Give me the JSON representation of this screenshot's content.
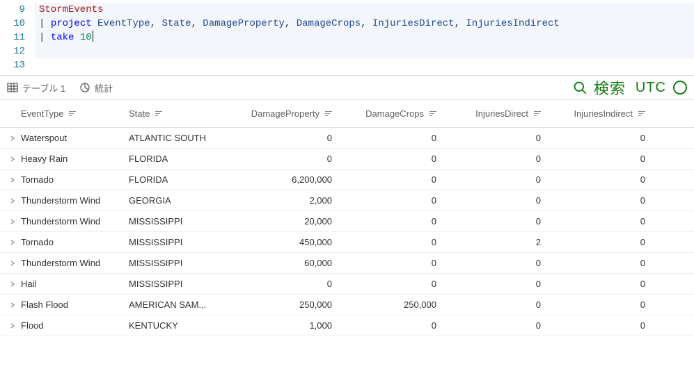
{
  "editor": {
    "lines": [
      {
        "no": "9",
        "seg": [
          {
            "c": "t-tbl",
            "t": "StormEvents"
          }
        ]
      },
      {
        "no": "10",
        "seg": [
          {
            "c": "t-pipe",
            "t": "| "
          },
          {
            "c": "t-op",
            "t": "project"
          },
          {
            "c": "",
            "t": " "
          },
          {
            "c": "t-col",
            "t": "EventType"
          },
          {
            "c": "",
            "t": ", "
          },
          {
            "c": "t-col",
            "t": "State"
          },
          {
            "c": "",
            "t": ", "
          },
          {
            "c": "t-col",
            "t": "DamageProperty"
          },
          {
            "c": "",
            "t": ", "
          },
          {
            "c": "t-col",
            "t": "DamageCrops"
          },
          {
            "c": "",
            "t": ", "
          },
          {
            "c": "t-col",
            "t": "InjuriesDirect"
          },
          {
            "c": "",
            "t": ", "
          },
          {
            "c": "t-col",
            "t": "InjuriesIndirect"
          }
        ]
      },
      {
        "no": "11",
        "seg": [
          {
            "c": "t-pipe",
            "t": "| "
          },
          {
            "c": "t-op",
            "t": "take"
          },
          {
            "c": "",
            "t": " "
          },
          {
            "c": "t-num",
            "t": "10"
          }
        ],
        "cursor": true
      },
      {
        "no": "12",
        "seg": []
      },
      {
        "no": "13",
        "seg": [],
        "blank": true
      }
    ]
  },
  "toolbar": {
    "tab_table": "テーブル 1",
    "tab_stats": "統計",
    "search_label": "検索",
    "tz_label": "UTC"
  },
  "table": {
    "columns": {
      "type": "EventType",
      "state": "State",
      "dmgp": "DamageProperty",
      "dmgc": "DamageCrops",
      "injd": "InjuriesDirect",
      "inji": "InjuriesIndirect"
    },
    "rows": [
      {
        "type": "Waterspout",
        "state": "ATLANTIC SOUTH",
        "dmgp": "0",
        "dmgc": "0",
        "injd": "0",
        "inji": "0"
      },
      {
        "type": "Heavy Rain",
        "state": "FLORIDA",
        "dmgp": "0",
        "dmgc": "0",
        "injd": "0",
        "inji": "0"
      },
      {
        "type": "Tornado",
        "state": "FLORIDA",
        "dmgp": "6,200,000",
        "dmgc": "0",
        "injd": "0",
        "inji": "0"
      },
      {
        "type": "Thunderstorm Wind",
        "state": "GEORGIA",
        "dmgp": "2,000",
        "dmgc": "0",
        "injd": "0",
        "inji": "0"
      },
      {
        "type": "Thunderstorm Wind",
        "state": "MISSISSIPPI",
        "dmgp": "20,000",
        "dmgc": "0",
        "injd": "0",
        "inji": "0"
      },
      {
        "type": "Tornado",
        "state": "MISSISSIPPI",
        "dmgp": "450,000",
        "dmgc": "0",
        "injd": "2",
        "inji": "0"
      },
      {
        "type": "Thunderstorm Wind",
        "state": "MISSISSIPPI",
        "dmgp": "60,000",
        "dmgc": "0",
        "injd": "0",
        "inji": "0"
      },
      {
        "type": "Hail",
        "state": "MISSISSIPPI",
        "dmgp": "0",
        "dmgc": "0",
        "injd": "0",
        "inji": "0"
      },
      {
        "type": "Flash Flood",
        "state": "AMERICAN SAM...",
        "dmgp": "250,000",
        "dmgc": "250,000",
        "injd": "0",
        "inji": "0"
      },
      {
        "type": "Flood",
        "state": "KENTUCKY",
        "dmgp": "1,000",
        "dmgc": "0",
        "injd": "0",
        "inji": "0"
      }
    ]
  }
}
